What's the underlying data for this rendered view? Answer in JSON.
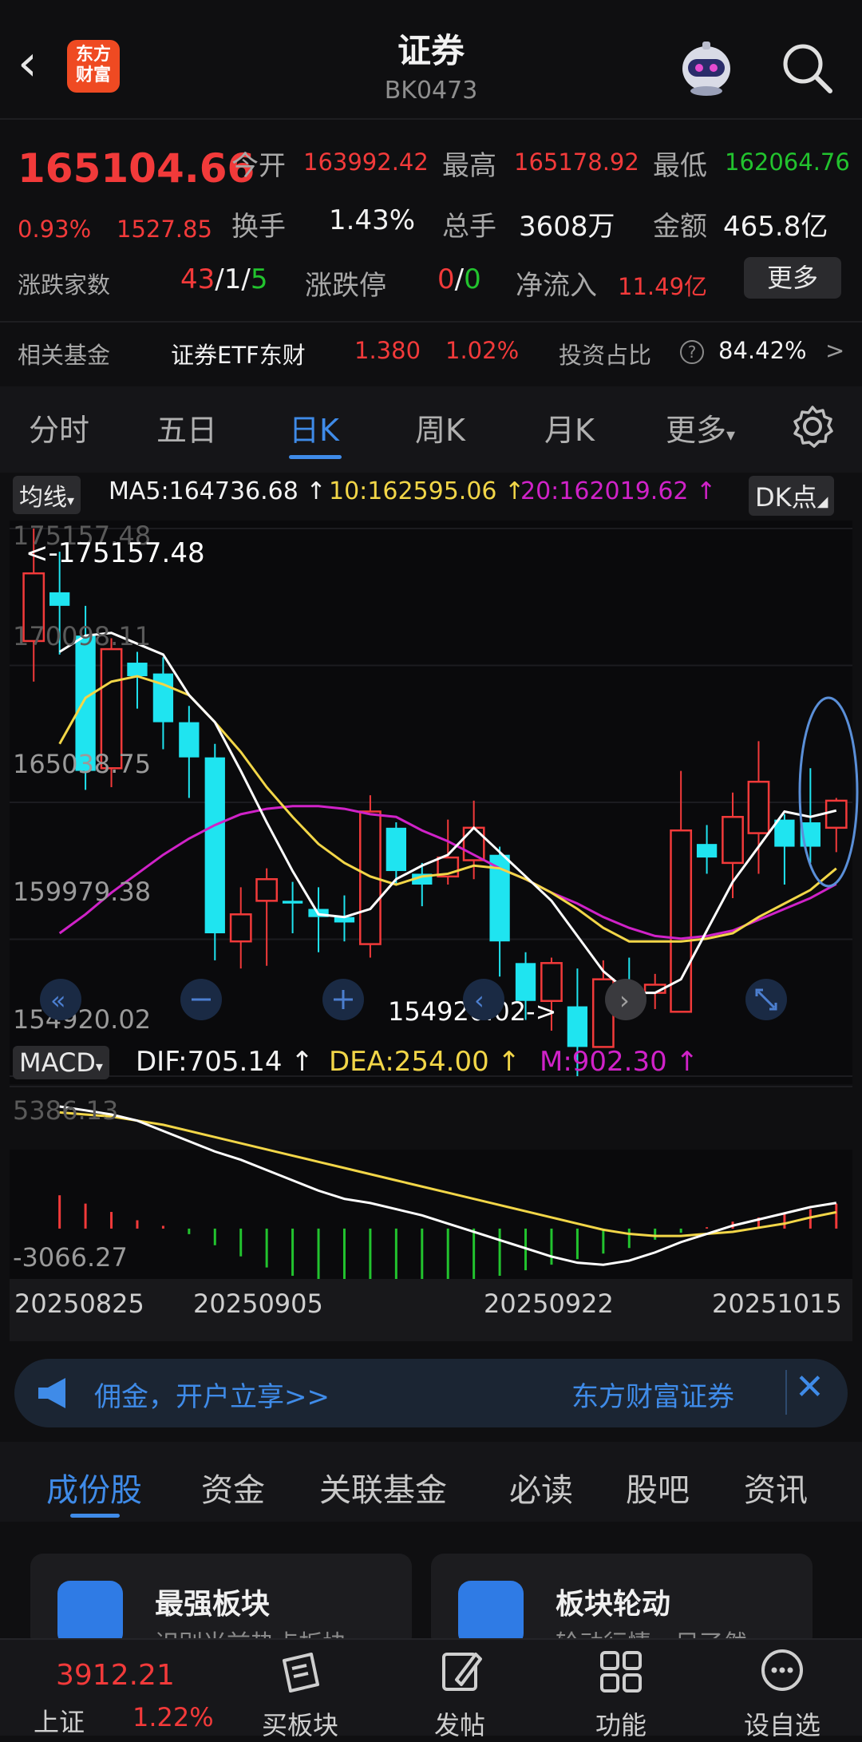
{
  "header": {
    "back": "‹",
    "logo": "东方\n财富",
    "title": "证券",
    "code": "BK0473"
  },
  "quote": {
    "price": "165104.66",
    "change_pct": "0.93%",
    "change_abs": "1527.85",
    "open_label": "今开",
    "open": "163992.42",
    "high_label": "最高",
    "high": "165178.92",
    "low_label": "最低",
    "low": "162064.76",
    "turnover_label": "换手",
    "turnover": "1.43%",
    "volume_label": "总手",
    "volume": "3608万",
    "amount_label": "金额",
    "amount": "465.8亿",
    "updown_label": "涨跌家数",
    "up": "43",
    "flat": "1",
    "down": "5",
    "limit_label": "涨跌停",
    "limit_up": "0",
    "limit_down": "0",
    "inflow_label": "净流入",
    "inflow": "11.49亿",
    "more": "更多"
  },
  "fund": {
    "label": "相关基金",
    "name": "证券ETF东财",
    "price": "1.380",
    "pct": "1.02%",
    "ratio_label": "投资占比",
    "ratio": "84.42%"
  },
  "tabs": [
    "分时",
    "五日",
    "日K",
    "周K",
    "月K",
    "更多"
  ],
  "ma": {
    "selector": "均线",
    "ma5": "MA5:164736.68",
    "ma10": "10:162595.06",
    "ma20": "20:162019.62",
    "dk": "DK点"
  },
  "axis": {
    "p1": "175157.48",
    "p2": "170098.11",
    "p3": "165038.75",
    "p4": "159979.38",
    "p5": "154920.02",
    "max_marker": "<-175157.48",
    "min_marker": "154920.02->"
  },
  "macd": {
    "selector": "MACD",
    "dif": "DIF:705.14",
    "dea": "DEA:254.00",
    "m": "M:902.30",
    "top": "5386.13",
    "bottom": "-3066.27"
  },
  "dates": [
    "20250825",
    "20250905",
    "20250922",
    "20251015"
  ],
  "banner": {
    "text": "佣金，开户立享>>",
    "brand": "东方财富证券"
  },
  "bottom_tabs": [
    "成份股",
    "资金",
    "关联基金",
    "必读",
    "股吧",
    "资讯"
  ],
  "cards": [
    {
      "title": "最强板块",
      "sub": "识别当前热点板块"
    },
    {
      "title": "板块轮动",
      "sub": "轮动行情一目了然"
    }
  ],
  "nav": {
    "index_price": "3912.21",
    "index_name": "上证",
    "index_pct": "1.22%",
    "items": [
      "买板块",
      "发帖",
      "功能",
      "设自选"
    ]
  },
  "colors": {
    "up": "#f23a3a",
    "down": "#22c32e",
    "accent": "#3f8be8",
    "cyan_candle": "#1fe4f0",
    "ma5": "#ffffff",
    "ma10": "#f2d648",
    "ma20": "#d022c8"
  },
  "chart_data": {
    "type": "candlestick",
    "x": [
      "20250825",
      "20250905",
      "20250922",
      "20251015"
    ],
    "ylim": [
      154920.02,
      175157.48
    ],
    "macd_ylim": [
      -3066.27,
      5386.13
    ],
    "candles": [
      {
        "o": 171000,
        "c": 173500,
        "h": 175157,
        "l": 169500
      },
      {
        "o": 172800,
        "c": 172300,
        "h": 174300,
        "l": 170500
      },
      {
        "o": 171200,
        "c": 166200,
        "h": 172300,
        "l": 165500
      },
      {
        "o": 166300,
        "c": 170700,
        "h": 171100,
        "l": 165600
      },
      {
        "o": 170200,
        "c": 169700,
        "h": 170600,
        "l": 168500
      },
      {
        "o": 169800,
        "c": 168000,
        "h": 170400,
        "l": 167000
      },
      {
        "o": 168000,
        "c": 166700,
        "h": 168600,
        "l": 165200
      },
      {
        "o": 166700,
        "c": 160200,
        "h": 167200,
        "l": 159200
      },
      {
        "o": 159900,
        "c": 160900,
        "h": 161900,
        "l": 158900
      },
      {
        "o": 161400,
        "c": 162200,
        "h": 162600,
        "l": 159000
      },
      {
        "o": 161400,
        "c": 161300,
        "h": 162100,
        "l": 160200
      },
      {
        "o": 161100,
        "c": 160800,
        "h": 161900,
        "l": 159500
      },
      {
        "o": 160800,
        "c": 160600,
        "h": 161600,
        "l": 159900
      },
      {
        "o": 159800,
        "c": 164700,
        "h": 165300,
        "l": 159300
      },
      {
        "o": 164100,
        "c": 162500,
        "h": 164300,
        "l": 162000
      },
      {
        "o": 162400,
        "c": 162000,
        "h": 162800,
        "l": 161200
      },
      {
        "o": 162300,
        "c": 163000,
        "h": 164400,
        "l": 162000
      },
      {
        "o": 162900,
        "c": 164100,
        "h": 165100,
        "l": 162200
      },
      {
        "o": 163100,
        "c": 159900,
        "h": 163400,
        "l": 158600
      },
      {
        "o": 159100,
        "c": 157700,
        "h": 159500,
        "l": 157000
      },
      {
        "o": 157700,
        "c": 159100,
        "h": 159300,
        "l": 156600
      },
      {
        "o": 157500,
        "c": 156000,
        "h": 158900,
        "l": 154920
      },
      {
        "o": 156000,
        "c": 158500,
        "h": 159200,
        "l": 156200
      },
      {
        "o": 158200,
        "c": 158000,
        "h": 159300,
        "l": 157500
      },
      {
        "o": 158000,
        "c": 158300,
        "h": 158700,
        "l": 157400
      },
      {
        "o": 157300,
        "c": 164000,
        "h": 166200,
        "l": 157300
      },
      {
        "o": 163500,
        "c": 163000,
        "h": 164200,
        "l": 162400
      },
      {
        "o": 162800,
        "c": 164500,
        "h": 165400,
        "l": 161500
      },
      {
        "o": 163900,
        "c": 165800,
        "h": 167300,
        "l": 162400
      },
      {
        "o": 164400,
        "c": 163400,
        "h": 164600,
        "l": 162000
      },
      {
        "o": 164300,
        "c": 163400,
        "h": 166300,
        "l": 162800
      },
      {
        "o": 164100,
        "c": 165100,
        "h": 165200,
        "l": 163200
      }
    ],
    "ma5": [
      170600,
      171200,
      171300,
      170900,
      170500,
      169000,
      168000,
      166200,
      164300,
      162500,
      160900,
      160800,
      161100,
      162200,
      162700,
      163100,
      164100,
      163200,
      162300,
      161400,
      160100,
      158800,
      158000,
      158000,
      158500,
      160300,
      162100,
      163400,
      164700,
      164500,
      164736
    ],
    "ma10": [
      167200,
      168900,
      169500,
      169700,
      169400,
      169000,
      168000,
      166900,
      165600,
      164500,
      163500,
      162800,
      162300,
      162000,
      162300,
      162400,
      162700,
      162600,
      162200,
      161700,
      161100,
      160400,
      159900,
      159900,
      159900,
      160000,
      160200,
      160800,
      161300,
      161800,
      162595
    ],
    "ma20": [
      160200,
      160900,
      161700,
      162400,
      163100,
      163700,
      164200,
      164600,
      164800,
      164900,
      164900,
      164800,
      164600,
      164500,
      164000,
      163600,
      163100,
      162600,
      162200,
      161700,
      161300,
      160800,
      160400,
      160100,
      160000,
      160100,
      160300,
      160700,
      161100,
      161500,
      162019
    ],
    "dif": [
      5386,
      5200,
      5000,
      4700,
      4200,
      3700,
      3200,
      2800,
      2300,
      1800,
      1300,
      900,
      700,
      400,
      100,
      -300,
      -700,
      -1100,
      -1500,
      -1900,
      -2200,
      -2300,
      -2100,
      -1700,
      -1200,
      -800,
      -400,
      -100,
      200,
      500,
      705
    ],
    "dea": [
      5100,
      5000,
      4900,
      4700,
      4500,
      4200,
      3900,
      3600,
      3300,
      3000,
      2700,
      2400,
      2100,
      1800,
      1500,
      1200,
      900,
      600,
      300,
      0,
      -300,
      -600,
      -800,
      -900,
      -900,
      -800,
      -700,
      -500,
      -300,
      0,
      254
    ],
    "macd_bar": [
      1200,
      900,
      600,
      300,
      100,
      -200,
      -600,
      -1000,
      -1400,
      -1700,
      -2000,
      -2200,
      -2300,
      -2300,
      -2200,
      -2100,
      -1900,
      -1700,
      -1500,
      -1300,
      -1100,
      -900,
      -700,
      -400,
      -150,
      50,
      250,
      400,
      550,
      700,
      902
    ]
  }
}
